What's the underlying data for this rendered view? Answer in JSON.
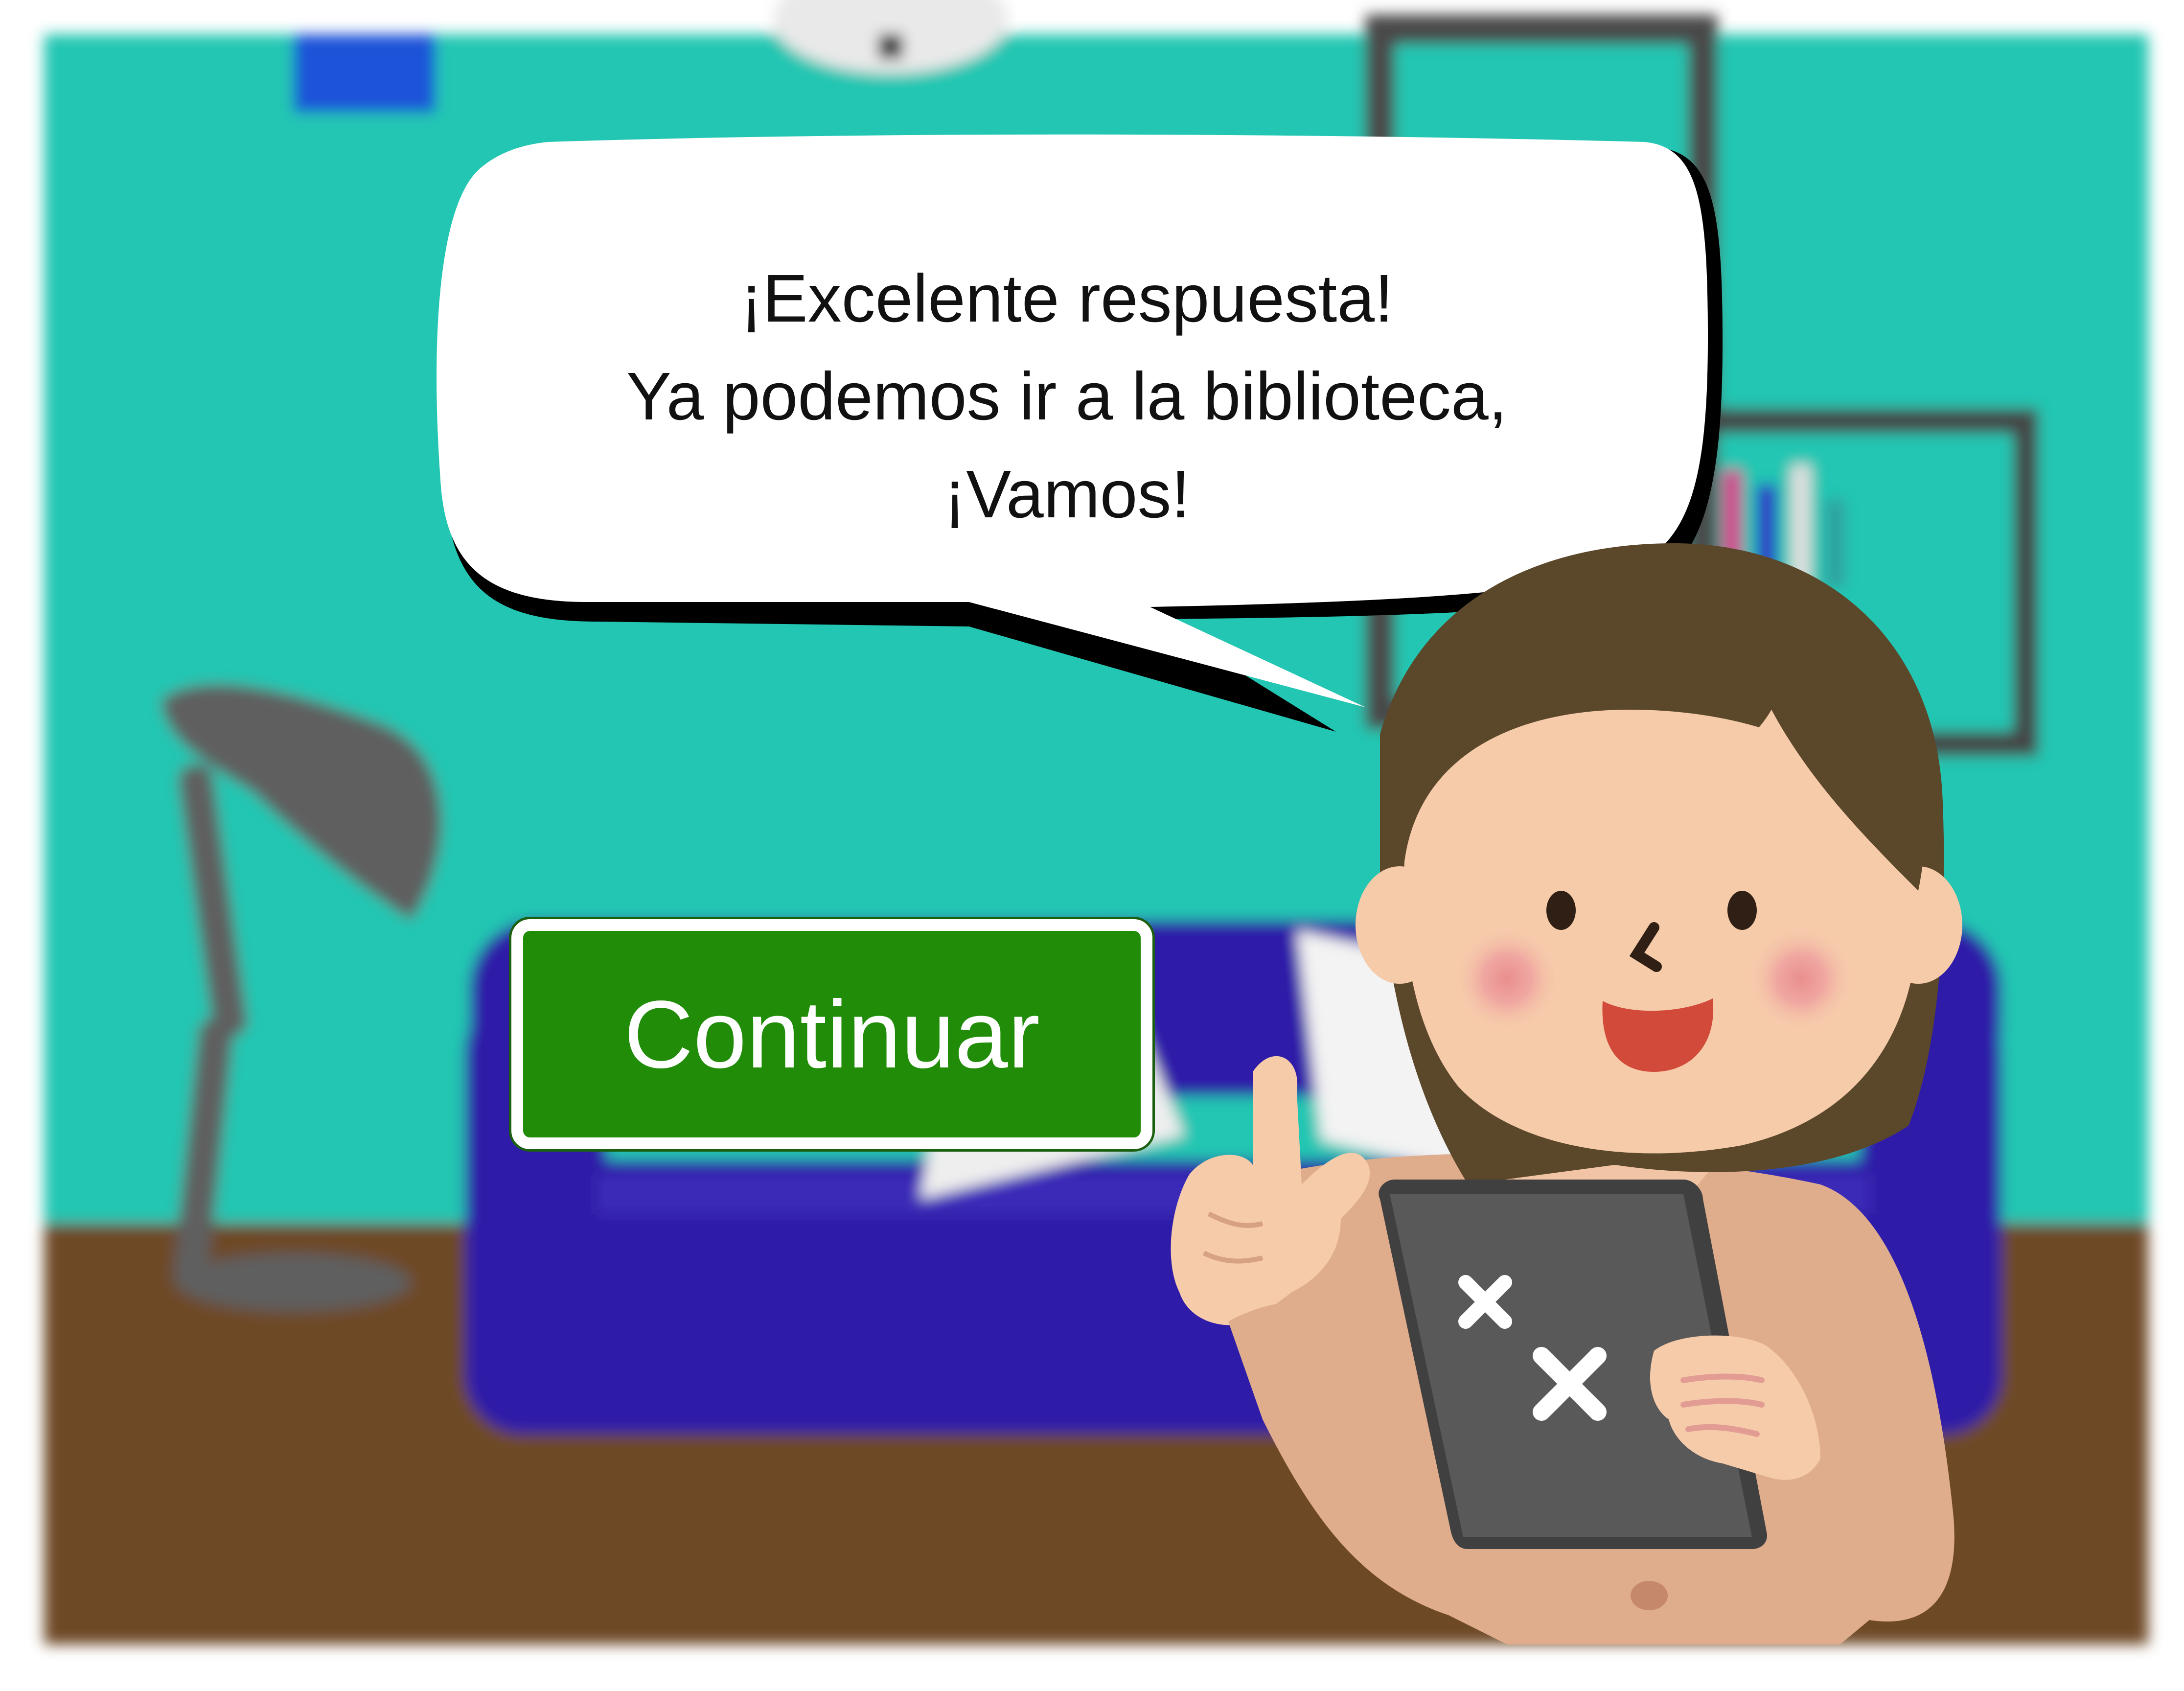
{
  "speech_bubble": {
    "line1": "¡Excelente respuesta!",
    "line2": "Ya podemos ir a la biblioteca,",
    "line3": "¡Vamos!"
  },
  "continue_button": {
    "label": "Continuar"
  },
  "colors": {
    "wall": "#22C6B2",
    "floor": "#6E4827",
    "sofa": "#2E1FA8",
    "button_green": "#218C08",
    "tablet": "#595959",
    "hair": "#5B472A",
    "skin": "#F6CBAA",
    "jacket": "#DFAC8C"
  },
  "icons": [
    "lamp-icon",
    "clock-icon",
    "tablet-x-icon"
  ]
}
